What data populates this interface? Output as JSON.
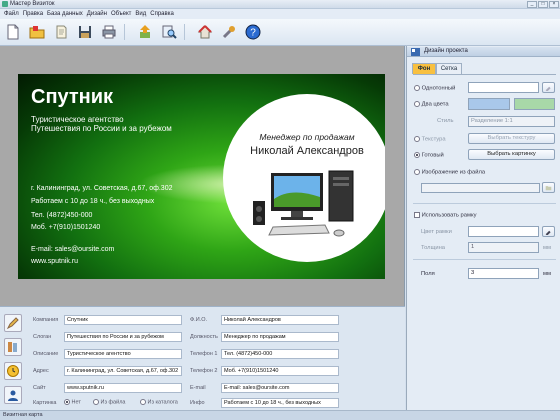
{
  "window": {
    "title": "Мастер Визиток",
    "btn_min": "_",
    "btn_max": "□",
    "btn_close": "×"
  },
  "menu": [
    "Файл",
    "Правка",
    "База данных",
    "Дизайн",
    "Объект",
    "Вид",
    "Справка"
  ],
  "card": {
    "company": "Спутник",
    "slogan_line1": "Туристическое агентство",
    "slogan_line2": "Путешествия по России и за рубежом",
    "address": "г. Калининград, ул. Советская, д.67, оф.302",
    "hours": "Работаем с 10 до 18 ч., без выходных",
    "phone1": "Тел. (4872)450-000",
    "phone2": "Моб. +7(910)1501240",
    "email": "E-mail: sales@oursite.com",
    "site": "www.sputnik.ru",
    "position": "Менеджер по продажам",
    "name": "Николай Александров"
  },
  "props": {
    "company": {
      "label": "Компания",
      "value": "Спутник"
    },
    "slogan": {
      "label": "Слоган",
      "value": "Путешествия по России и за рубежом"
    },
    "description": {
      "label": "Описание",
      "value": "Туристическое агентство"
    },
    "address": {
      "label": "Адрес",
      "value": "г. Калининград, ул. Советская, д.67, оф.302"
    },
    "site": {
      "label": "Сайт",
      "value": "www.sputnik.ru"
    },
    "picture": {
      "label": "Картинка",
      "opt_none": "Нет",
      "opt_file": "Из файла",
      "opt_catalog": "Из каталога"
    },
    "fio": {
      "label": "Ф.И.О.",
      "value": "Николай Александров"
    },
    "position": {
      "label": "Должность",
      "value": "Менеджер по продажам"
    },
    "phone1": {
      "label": "Телефон 1",
      "value": "Тел. (4872)450-000"
    },
    "phone2": {
      "label": "Телефон 2",
      "value": "Моб. +7(910)1501240"
    },
    "email": {
      "label": "E-mail",
      "value": "E-mail: sales@oursite.com"
    },
    "info": {
      "label": "Инфо",
      "value": "Работаем с 10 до 18 ч., без выходных"
    }
  },
  "panel": {
    "title": "Дизайн проекта",
    "tab_bg": "Фон",
    "tab_grid": "Сетка",
    "solid": "Однотонный",
    "two_colors": "Два цвета",
    "style_label": "Стиль",
    "style_value": "Разделение 1:1",
    "texture": "Текстура",
    "choose_texture": "Выбрать текстуру",
    "ready": "Готовый",
    "choose_picture": "Выбрать картинку",
    "image_from_file": "Изображение из файла",
    "use_frame": "Использовать рамку",
    "frame_color": "Цвет рамки",
    "thickness": "Толщина",
    "thickness_value": "1",
    "unit": "мм",
    "margins": "Поля",
    "margins_value": "3"
  },
  "status": "Визитная карта",
  "colors": {
    "two_color_a": "#a9c8ea",
    "two_color_b": "#a8d8a8"
  }
}
